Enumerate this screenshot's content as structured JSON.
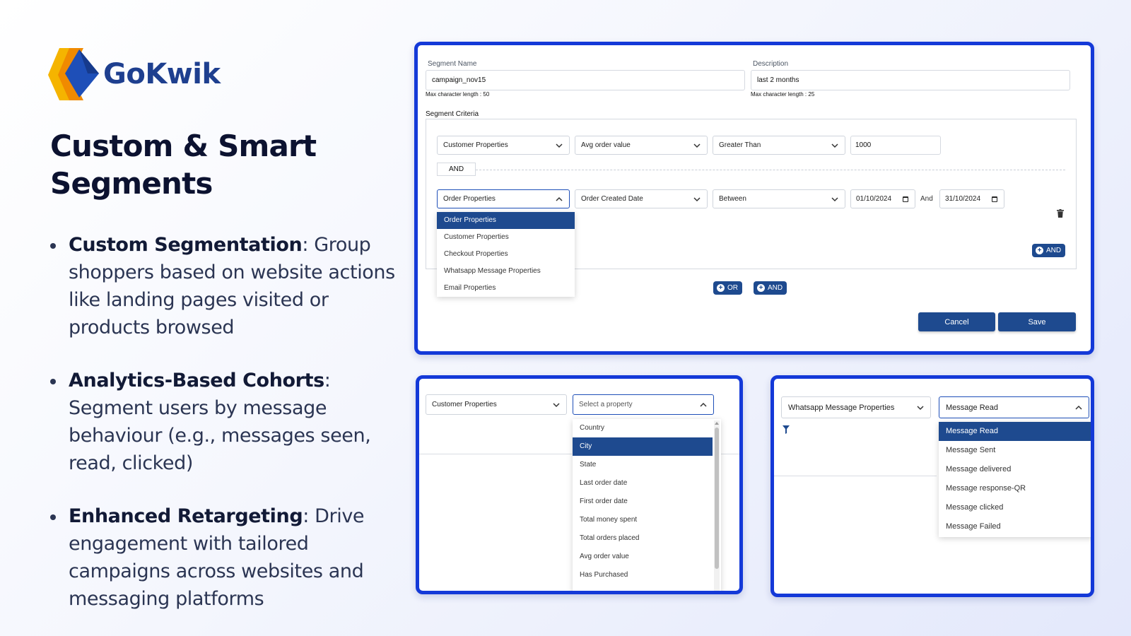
{
  "brand": {
    "name": "GoKwik"
  },
  "headline": "Custom & Smart Segments",
  "bullets": [
    {
      "title": "Custom Segmentation",
      "text": ": Group shoppers based on website actions like landing pages visited or products browsed"
    },
    {
      "title": "Analytics-Based Cohorts",
      "text": ": Segment users by message behaviour (e.g., messages seen, read, clicked)"
    },
    {
      "title": "Enhanced Retargeting",
      "text": ": Drive engagement with tailored campaigns across websites and messaging platforms"
    }
  ],
  "form": {
    "segment_name_label": "Segment Name",
    "segment_name_value": "campaign_nov15",
    "segment_name_hint": "Max character length : 50",
    "description_label": "Description",
    "description_value": "last 2 months",
    "description_hint": "Max character length : 25",
    "criteria_label": "Segment Criteria",
    "row1": {
      "category": "Customer Properties",
      "property": "Avg order value",
      "operator": "Greater Than",
      "value": "1000"
    },
    "and_label": "AND",
    "row2": {
      "category": "Order Properties",
      "property": "Order Created Date",
      "operator": "Between",
      "date_from": "01/10/2024",
      "and_text": "And",
      "date_to": "31/10/2024"
    },
    "category_options": [
      "Order Properties",
      "Customer Properties",
      "Checkout Properties",
      "Whatsapp Message Properties",
      "Email Properties"
    ],
    "inner_and_button": "AND",
    "or_button": "OR",
    "outer_and_button": "AND",
    "cancel_button": "Cancel",
    "save_button": "Save"
  },
  "customer_panel": {
    "category": "Customer Properties",
    "property_placeholder": "Select a property",
    "options": [
      "Country",
      "City",
      "State",
      "Last order date",
      "First order date",
      "Total money spent",
      "Total orders placed",
      "Avg order value",
      "Has Purchased"
    ],
    "selected": "City"
  },
  "whatsapp_panel": {
    "category": "Whatsapp Message Properties",
    "property": "Message Read",
    "options": [
      "Message Read",
      "Message Sent",
      "Message delivered",
      "Message response-QR",
      "Message clicked",
      "Message Failed"
    ],
    "selected": "Message Read"
  },
  "colors": {
    "accent": "#1e4a8f",
    "panel_border": "#1439d8",
    "brand_blue": "#1e3f8f",
    "brand_yellow": "#f5b400"
  }
}
